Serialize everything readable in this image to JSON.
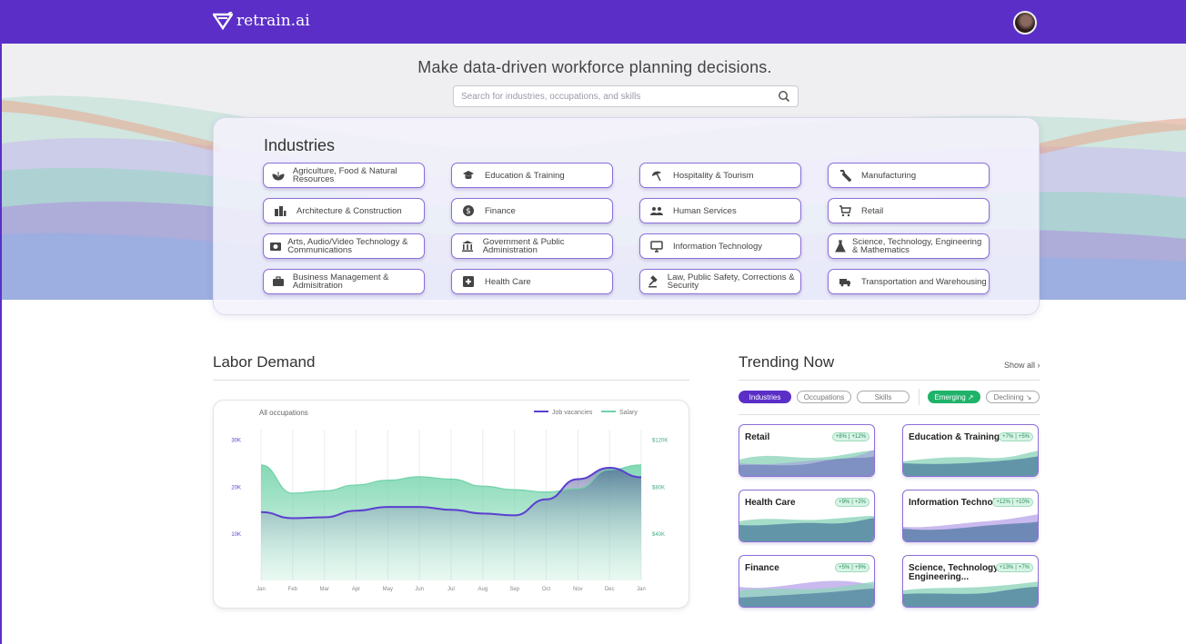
{
  "app": {
    "name": "retrain.ai"
  },
  "hero": {
    "headline": "Make data-driven workforce planning decisions.",
    "search_placeholder": "Search for industries, occupations, and skills"
  },
  "industries": {
    "title": "Industries",
    "items": [
      {
        "label": "Agriculture, Food & Natural Resources",
        "icon": "plant-icon"
      },
      {
        "label": "Education & Training",
        "icon": "graduation-cap-icon"
      },
      {
        "label": "Hospitality & Tourism",
        "icon": "beach-umbrella-icon"
      },
      {
        "label": "Manufacturing",
        "icon": "wrench-icon"
      },
      {
        "label": "Architecture & Construction",
        "icon": "buildings-icon"
      },
      {
        "label": "Finance",
        "icon": "dollar-coin-icon"
      },
      {
        "label": "Human Services",
        "icon": "people-icon"
      },
      {
        "label": "Retail",
        "icon": "shopping-cart-icon"
      },
      {
        "label": "Arts, Audio/Video Technology & Communications",
        "icon": "camera-icon"
      },
      {
        "label": "Government & Public Administration",
        "icon": "government-building-icon"
      },
      {
        "label": "Information Technology",
        "icon": "monitor-icon"
      },
      {
        "label": "Science, Technology, Engineering & Mathematics",
        "icon": "flask-icon"
      },
      {
        "label": "Business Management & Admisitration",
        "icon": "briefcase-icon"
      },
      {
        "label": "Health Care",
        "icon": "medical-cross-icon"
      },
      {
        "label": "Law, Public Safety, Corrections & Security",
        "icon": "gavel-icon"
      },
      {
        "label": "Transportation and Warehousing",
        "icon": "truck-icon"
      }
    ]
  },
  "labor_demand": {
    "title": "Labor Demand",
    "subtitle": "All occupations",
    "legend": {
      "job_vacancies": "Job vacancies",
      "salary": "Salary"
    },
    "colors": {
      "vacancies": "#5b3fd0",
      "salary": "#6fd2a8"
    }
  },
  "chart_data": {
    "type": "area",
    "x": [
      "Jan",
      "Feb",
      "Mar",
      "Apr",
      "May",
      "Jun",
      "Jul",
      "Aug",
      "Sep",
      "Oct",
      "Nov",
      "Dec",
      "Jan"
    ],
    "series": [
      {
        "name": "Job vacancies",
        "axis": "left",
        "values": [
          14500,
          13200,
          13400,
          14800,
          15600,
          15600,
          15000,
          14200,
          13800,
          17200,
          21500,
          23900,
          21900
        ]
      },
      {
        "name": "Salary",
        "axis": "right",
        "values": [
          98000,
          74000,
          76000,
          81000,
          85000,
          88000,
          86000,
          80000,
          77000,
          75000,
          78000,
          94000,
          98000
        ]
      }
    ],
    "y_left": {
      "ticks": [
        "10K",
        "20K",
        "30K"
      ],
      "range": [
        0,
        32000
      ]
    },
    "y_right": {
      "ticks": [
        "$40K",
        "$80K",
        "$120K"
      ],
      "range": [
        0,
        128000
      ]
    },
    "grid": "vertical",
    "legend_position": "top-right"
  },
  "trending": {
    "title": "Trending Now",
    "show_all": "Show all",
    "filters": [
      "Industries",
      "Occupations",
      "Skills"
    ],
    "trend_filters": [
      "Emerging",
      "Declining"
    ],
    "cards": [
      {
        "name": "Retail",
        "badge1": "+8%",
        "badge2": "+12%"
      },
      {
        "name": "Education & Training",
        "badge1": "+7%",
        "badge2": "+5%"
      },
      {
        "name": "Health Care",
        "badge1": "+9%",
        "badge2": "+2%"
      },
      {
        "name": "Information Technology",
        "badge1": "+12%",
        "badge2": "+10%"
      },
      {
        "name": "Finance",
        "badge1": "+5%",
        "badge2": "+9%"
      },
      {
        "name": "Science, Technology, Engineering...",
        "badge1": "+13%",
        "badge2": "+7%"
      }
    ]
  }
}
